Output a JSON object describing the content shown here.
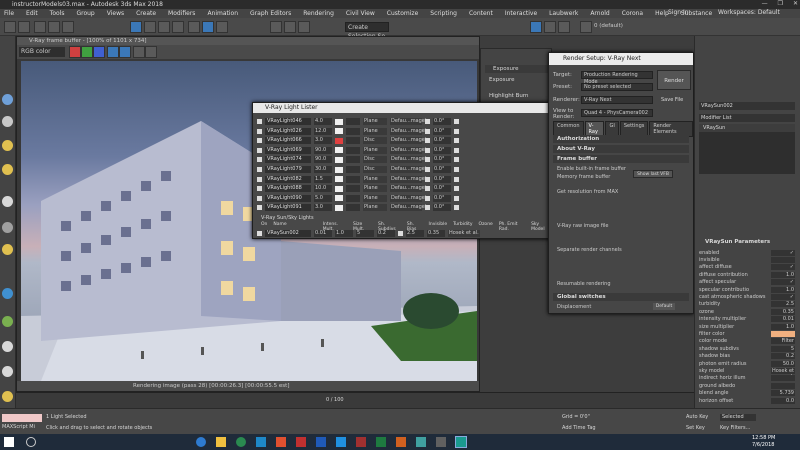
{
  "window": {
    "title": "instructorModels03.max - Autodesk 3ds Max 2018",
    "controls": [
      "—",
      "❐",
      "✕"
    ]
  },
  "menubar": {
    "items": [
      "File",
      "Edit",
      "Tools",
      "Group",
      "Views",
      "Create",
      "Modifiers",
      "Animation",
      "Graph Editors",
      "Rendering",
      "Civil View",
      "Customize",
      "Scripting",
      "Content",
      "Interactive",
      "Laubwerk",
      "Arnold",
      "Corona",
      "Help",
      "Substance"
    ],
    "sign_in": "Sign In",
    "workspaces_label": "Workspaces:",
    "workspaces_value": "Default"
  },
  "toolbar": {
    "selection_set": "Create Selection Se",
    "layer": "0 (default)"
  },
  "frame_buffer": {
    "title": "V-Ray frame buffer - [100% of 1101 x 734]",
    "channel": "RGB color",
    "status": "Rendering image (pass 28) [00:00:26.3] [00:00:55.5 est]"
  },
  "fb_side": {
    "exposure_header": "Exposure",
    "exposure": "Exposure",
    "highlight_burn": "Highlight Burn"
  },
  "light_lister": {
    "title": "V-Ray Light Lister",
    "rows": [
      {
        "name": "VRayLight046",
        "mult": "4.0",
        "shape": "Plane",
        "default": "Defau...mage)",
        "angle": "0.0°",
        "color": "#f0f0f0"
      },
      {
        "name": "VRayLight026",
        "mult": "12.0",
        "shape": "Plane",
        "default": "Defau...mage)",
        "angle": "0.0°",
        "color": "#f0f0f0"
      },
      {
        "name": "VRayLight066",
        "mult": "3.0",
        "shape": "Disc",
        "default": "Defau...mage)",
        "angle": "0.0°",
        "color": "#e04040"
      },
      {
        "name": "VRayLight069",
        "mult": "90.0",
        "shape": "Plane",
        "default": "Defau...mage)",
        "angle": "0.0°",
        "color": "#f0f0f0"
      },
      {
        "name": "VRayLight074",
        "mult": "90.0",
        "shape": "Disc",
        "default": "Defau...mage)",
        "angle": "0.0°",
        "color": "#f0f0f0"
      },
      {
        "name": "VRayLight079",
        "mult": "30.0",
        "shape": "Disc",
        "default": "Defau...mage)",
        "angle": "0.0°",
        "color": "#f0f0f0"
      },
      {
        "name": "VRayLight082",
        "mult": "1.5",
        "shape": "Plane",
        "default": "Defau...mage)",
        "angle": "0.0°",
        "color": "#f0f0f0"
      },
      {
        "name": "VRayLight088",
        "mult": "10.0",
        "shape": "Plane",
        "default": "Defau...mage)",
        "angle": "0.0°",
        "color": "#f0f0f0"
      },
      {
        "name": "VRayLight090",
        "mult": "5.0",
        "shape": "Plane",
        "default": "Defau...mage)",
        "angle": "0.0°",
        "color": "#f0f0f0"
      },
      {
        "name": "VRayLight091",
        "mult": "3.0",
        "shape": "Plane",
        "default": "Defau...mage)",
        "angle": "0.0°",
        "color": "#f0f0f0"
      }
    ],
    "sunsky_header": "V-Ray Sun/Sky Lights",
    "sunsky_columns": [
      "On",
      "Name",
      "Intens. Mult.",
      "Size Mult.",
      "Sh. Subdivs",
      "Sh. Bias",
      "Invisible",
      "Turbidity",
      "Ozone",
      "Ph. Emit Rad.",
      "Sky Model"
    ],
    "sun": {
      "name": "VRaySun002",
      "intens": "0.01",
      "size": "1.0",
      "subdivs": "5",
      "bias": "0.2",
      "turbidity": "2.5",
      "ozone": "0.35",
      "model": "Hosek et al."
    }
  },
  "render_setup": {
    "title": "Render Setup: V-Ray Next",
    "target_label": "Target:",
    "target": "Production Rendering Mode",
    "preset_label": "Preset:",
    "preset": "No preset selected",
    "renderer_label": "Renderer:",
    "renderer": "V-Ray Next",
    "save_file": "Save File",
    "view_label": "View to Render:",
    "view": "Quad 4 - PhysCamera002",
    "render_btn": "Render",
    "tabs": [
      "Common",
      "V-Ray",
      "GI",
      "Settings",
      "Render Elements"
    ],
    "sections": [
      "Authorization",
      "About V-Ray",
      "Frame buffer"
    ],
    "fb_opts": [
      "Enable built-in frame buffer",
      "Memory frame buffer",
      "Show last VFB",
      "Get resolution from MAX",
      "V-Ray raw image file",
      "Separate render channels",
      "Resumable rendering"
    ],
    "global_switches": "Global switches",
    "displacement": "Displacement",
    "default": "Default"
  },
  "command_panel": {
    "object_name": "VRaySun002",
    "modifier_list": "Modifier List",
    "stack_item": "VRaySun",
    "params_header": "VRaySun Parameters",
    "params": [
      {
        "label": "enabled",
        "value": "✓"
      },
      {
        "label": "invisible",
        "value": ""
      },
      {
        "label": "affect diffuse",
        "value": "✓"
      },
      {
        "label": "diffuse contribution",
        "value": "1.0"
      },
      {
        "label": "affect specular",
        "value": "✓"
      },
      {
        "label": "specular contributio",
        "value": "1.0"
      },
      {
        "label": "cast atmospheric shadows",
        "value": "✓"
      },
      {
        "label": "turbidity",
        "value": "2.5"
      },
      {
        "label": "ozone",
        "value": "0.35"
      },
      {
        "label": "intensity multiplier",
        "value": "0.01"
      },
      {
        "label": "size multiplier",
        "value": "1.0"
      },
      {
        "label": "filter color",
        "value": ""
      },
      {
        "label": "color mode",
        "value": "Filter"
      },
      {
        "label": "shadow subdivs",
        "value": "5"
      },
      {
        "label": "shadow bias",
        "value": "0.2"
      },
      {
        "label": "photon emit radius",
        "value": "50.0"
      },
      {
        "label": "sky model",
        "value": "Hosek et al."
      },
      {
        "label": "indirect horiz illum",
        "value": ""
      },
      {
        "label": "ground albedo",
        "value": ""
      },
      {
        "label": "blend angle",
        "value": "5.739"
      },
      {
        "label": "horizon offset",
        "value": "0.0"
      }
    ]
  },
  "timeline": {
    "frame": "0 / 100"
  },
  "status": {
    "maxscript": "MAXScript Mi",
    "selected": "1 Light Selected",
    "hint": "Click and drag to select and rotate objects",
    "grid": "Grid = 0'0\"",
    "add_time_tag": "Add Time Tag",
    "auto_key": "Auto Key",
    "selected_dd": "Selected",
    "set_key": "Set Key",
    "key_filters": "Key Filters..."
  },
  "taskbar": {
    "time": "12:58 PM",
    "date": "7/6/2018"
  }
}
